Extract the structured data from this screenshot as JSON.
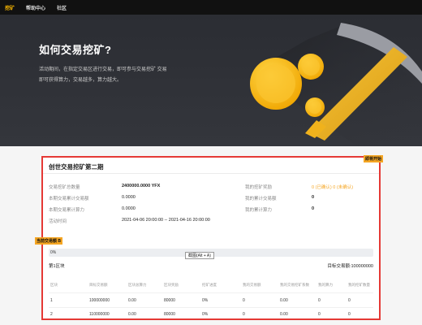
{
  "nav": {
    "items": [
      {
        "label": "挖矿",
        "active": true
      },
      {
        "label": "帮助中心",
        "active": false
      },
      {
        "label": "社区",
        "active": false
      }
    ]
  },
  "hero": {
    "title": "如何交易挖矿?",
    "desc_line1": "活动期间，在指定交易区进行交易，即可参与交易挖矿 交易",
    "desc_line2": "即可获得算力，交易越多，算力越大。"
  },
  "badges": {
    "top": "即将开始",
    "left": "当前交易额 B"
  },
  "card": {
    "title": "创世交易挖矿第二期",
    "left_info": [
      {
        "label": "交易挖矿总数量",
        "value": "2400000.0000 YFX"
      },
      {
        "label": "本期交易累计交易额",
        "value": "0.0000"
      },
      {
        "label": "本期交易累计算力",
        "value": "0.0000"
      },
      {
        "label": "活动时间",
        "value": "2021-04-06 20:00:00 -- 2021-04-16 20:00:00"
      }
    ],
    "right_info": [
      {
        "label": "我的挖矿奖励",
        "value": "0 (已确认) 0 (未确认)"
      },
      {
        "label": "我的累计交易额",
        "value": "0"
      },
      {
        "label": "我的累计算力",
        "value": "0"
      }
    ],
    "progress": {
      "text": "0%",
      "value": 0
    },
    "screenshot_button": "截图(Alt + A)",
    "block_title": "第1区块",
    "block_target": "目标交易额:100000000",
    "table": {
      "headers": [
        "区块",
        "目标交易额",
        "区块总算力",
        "区块奖励",
        "挖矿进度",
        "我的交易额",
        "我的交易挖矿系数",
        "我的算力",
        "我的挖矿数量"
      ],
      "rows": [
        [
          "1",
          "100000000",
          "0.00",
          "80000",
          "0%",
          "0",
          "0.00",
          "0",
          "0"
        ],
        [
          "2",
          "110000000",
          "0.00",
          "80000",
          "0%",
          "0",
          "0.00",
          "0",
          "0"
        ]
      ]
    }
  },
  "colors": {
    "accent": "#f5a623",
    "frame": "#e53935",
    "nav_bg": "#111111",
    "hero_bg": "#2b2d33"
  }
}
